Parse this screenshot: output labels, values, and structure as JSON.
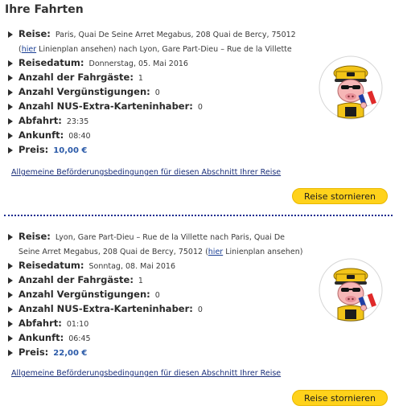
{
  "page": {
    "title": "Ihre Fahrten"
  },
  "labels": {
    "reise": "Reise:",
    "reisedatum": "Reisedatum:",
    "fahrgaeste": "Anzahl der Fahrgäste:",
    "verguenstigungen": "Anzahl Vergünstigungen:",
    "nus": "Anzahl NUS-Extra-Karteninhaber:",
    "abfahrt": "Abfahrt:",
    "ankunft": "Ankunft:",
    "preis": "Preis:"
  },
  "trips": [
    {
      "route_before": "Paris, Quai De Seine Arret Megabus, 208 Quai de Bercy, 75012 (",
      "link_text": "hier",
      "route_after": " Linienplan ansehen) nach Lyon, Gare Part-Dieu – Rue de la Villette",
      "date": "Donnerstag, 05. Mai 2016",
      "passengers": "1",
      "discounts": "0",
      "nus_holders": "0",
      "departure": "23:35",
      "arrival": "08:40",
      "price": "10,00 €",
      "terms_link": "Allgemeine Beförderungsbedingungen für diesen Abschnitt Ihrer Reise",
      "cancel_label": "Reise stornieren"
    },
    {
      "route_before": "Lyon, Gare Part-Dieu – Rue de la Villette nach Paris, Quai De Seine Arret Megabus, 208 Quai de Bercy, 75012 (",
      "link_text": "hier",
      "route_after": " Linienplan ansehen)",
      "date": "Sonntag, 08. Mai 2016",
      "passengers": "1",
      "discounts": "0",
      "nus_holders": "0",
      "departure": "01:10",
      "arrival": "06:45",
      "price": "22,00 €",
      "terms_link": "Allgemeine Beförderungsbedingungen für diesen Abschnitt Ihrer Reise",
      "cancel_label": "Reise stornieren"
    }
  ],
  "colors": {
    "accent_button": "#ffd21b",
    "link": "#1a3f94",
    "price": "#2b5aa8",
    "divider": "#1a2b8f"
  },
  "icons": {
    "mascot": "megabus-mascot-icon"
  }
}
